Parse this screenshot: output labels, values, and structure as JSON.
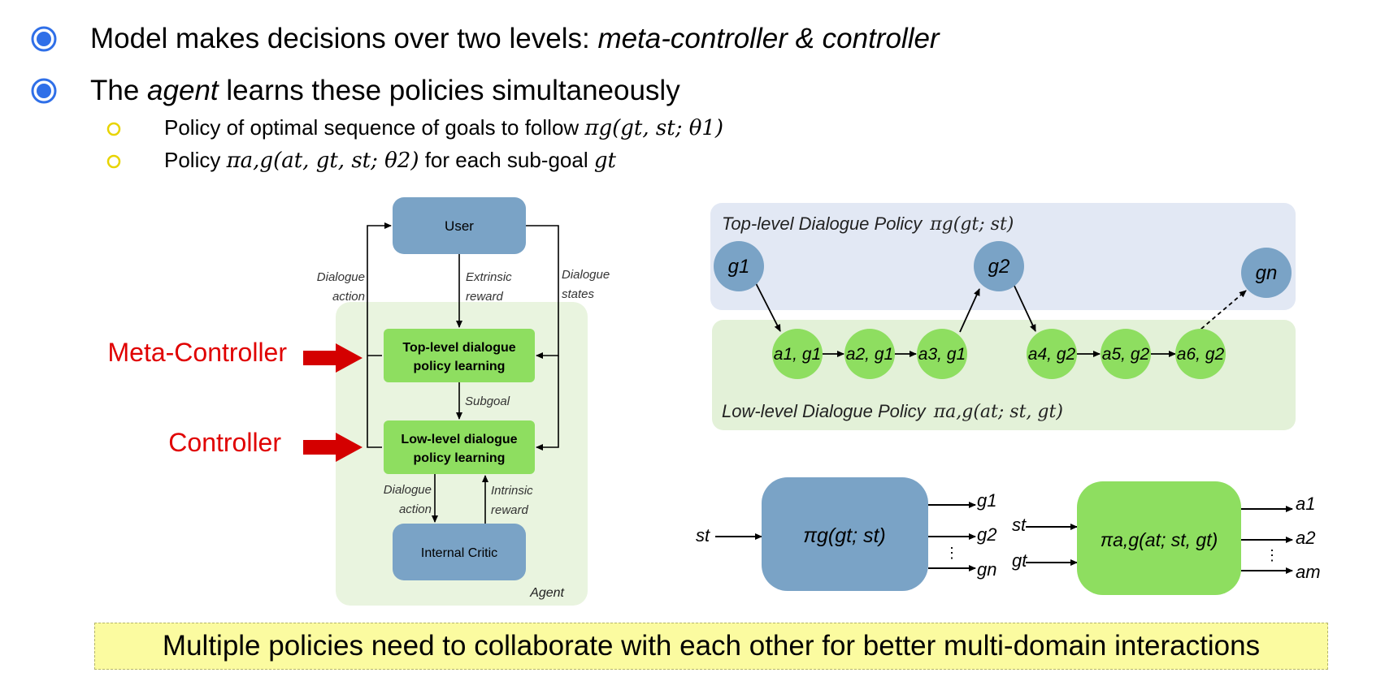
{
  "bullets": [
    {
      "text_plain": "Model makes decisions over two levels: ",
      "text_italic": "meta-controller & controller"
    },
    {
      "text_before": "The ",
      "text_italic": "agent",
      "text_after": " learns these policies simultaneously"
    }
  ],
  "sub_bullets": [
    {
      "text": "Policy of optimal sequence of goals to follow ",
      "math": "πg(gt, st; θ1)"
    },
    {
      "text_before": "Policy ",
      "math": "πa,g(at, gt, st; θ2)",
      "text_after": " for each sub-goal ",
      "math2": "gt"
    }
  ],
  "left_diagram": {
    "user": "User",
    "top_level": [
      "Top-level dialogue",
      "policy learning"
    ],
    "low_level": [
      "Low-level dialogue",
      "policy learning"
    ],
    "internal_critic": "Internal Critic",
    "agent_label": "Agent",
    "dialogue_action_top": [
      "Dialogue",
      "action"
    ],
    "extrinsic_reward": [
      "Extrinsic",
      "reward"
    ],
    "dialogue_states": [
      "Dialogue",
      "states"
    ],
    "subgoal": "Subgoal",
    "dialogue_action_bottom": [
      "Dialogue",
      "action"
    ],
    "intrinsic_reward": [
      "Intrinsic",
      "reward"
    ],
    "meta_controller": "Meta-Controller",
    "controller": "Controller"
  },
  "right_diagram": {
    "top_title": "Top-level Dialogue Policy",
    "top_math": "πg(gt; st)",
    "low_title": "Low-level Dialogue Policy",
    "low_math": "πa,g(at; st, gt)",
    "goals": [
      "g1",
      "g2",
      "gn"
    ],
    "actions": [
      "a1, g1",
      "a2, g1",
      "a3, g1",
      "a4, g2",
      "a5, g2",
      "a6, g2"
    ]
  },
  "bottom_diagram": {
    "left_input": "st",
    "left_box": "πg(gt; st)",
    "left_outputs": [
      "g1",
      "g2",
      "⋮",
      "gn"
    ],
    "right_inputs": [
      "st",
      "gt"
    ],
    "right_box": "πa,g(at; st, gt)",
    "right_outputs": [
      "a1",
      "a2",
      "⋮",
      "am"
    ]
  },
  "highlight_text": "Multiple policies need to collaborate with each other for better multi-domain interactions",
  "colors": {
    "blue_box": "#7aa3c6",
    "green_box": "#8ede60",
    "agent_bg": "#e9f4df",
    "top_band": "#e2e8f4",
    "low_band": "#e3f1d8",
    "red": "#e00000",
    "bullet_blue": "#2f6fe8",
    "sub_bullet": "#e8d400",
    "highlight_bg": "#fbfba0"
  }
}
